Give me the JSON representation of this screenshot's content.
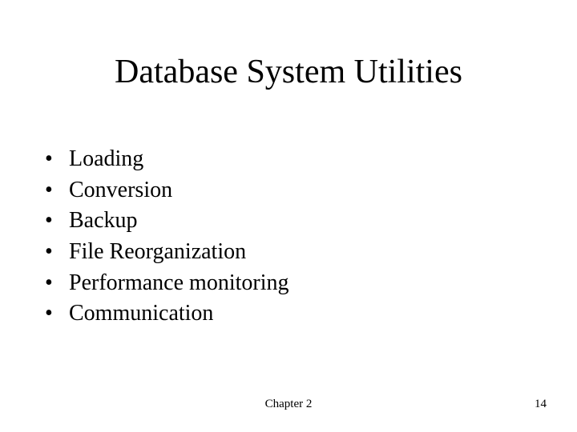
{
  "title": "Database System Utilities",
  "bullets": [
    "Loading",
    "Conversion",
    "Backup",
    "File Reorganization",
    "Performance monitoring",
    "Communication"
  ],
  "footer": {
    "center": "Chapter 2",
    "right": "14"
  }
}
